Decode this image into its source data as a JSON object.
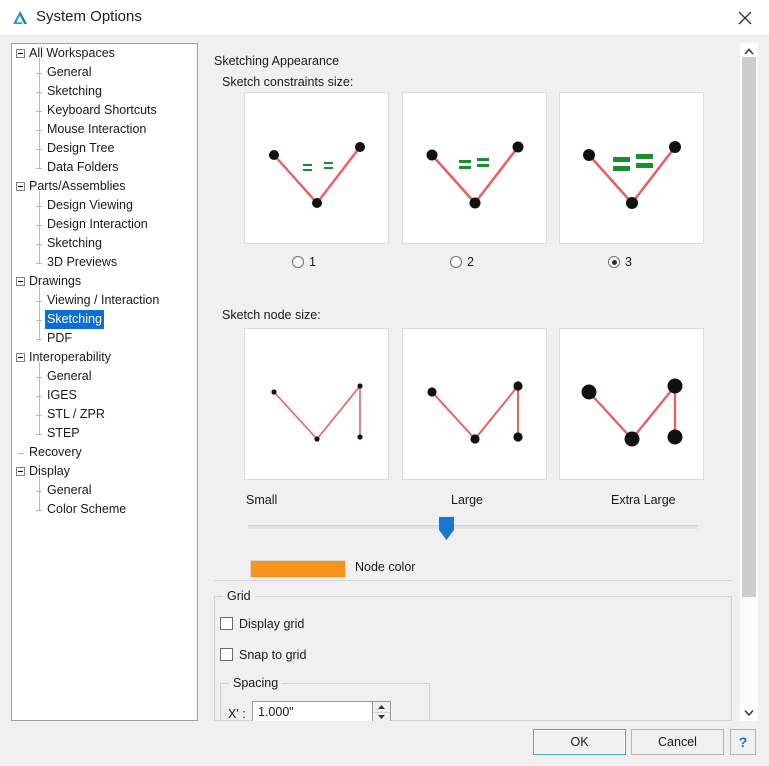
{
  "window": {
    "title": "System Options",
    "icon": "alibre-logo-icon",
    "close_icon": "close-icon"
  },
  "sidebar": {
    "items": [
      {
        "label": "All Workspaces",
        "level": 0,
        "expandable": true,
        "selected": false
      },
      {
        "label": "General",
        "level": 1,
        "expandable": false,
        "selected": false
      },
      {
        "label": "Sketching",
        "level": 1,
        "expandable": false,
        "selected": false
      },
      {
        "label": "Keyboard Shortcuts",
        "level": 1,
        "expandable": false,
        "selected": false
      },
      {
        "label": "Mouse Interaction",
        "level": 1,
        "expandable": false,
        "selected": false
      },
      {
        "label": "Design Tree",
        "level": 1,
        "expandable": false,
        "selected": false
      },
      {
        "label": "Data Folders",
        "level": 1,
        "expandable": false,
        "selected": false
      },
      {
        "label": "Parts/Assemblies",
        "level": 0,
        "expandable": true,
        "selected": false
      },
      {
        "label": "Design Viewing",
        "level": 1,
        "expandable": false,
        "selected": false
      },
      {
        "label": "Design Interaction",
        "level": 1,
        "expandable": false,
        "selected": false
      },
      {
        "label": "Sketching",
        "level": 1,
        "expandable": false,
        "selected": false
      },
      {
        "label": "3D Previews",
        "level": 1,
        "expandable": false,
        "selected": false
      },
      {
        "label": "Drawings",
        "level": 0,
        "expandable": true,
        "selected": false
      },
      {
        "label": "Viewing / Interaction",
        "level": 1,
        "expandable": false,
        "selected": false
      },
      {
        "label": "Sketching",
        "level": 1,
        "expandable": false,
        "selected": true
      },
      {
        "label": "PDF",
        "level": 1,
        "expandable": false,
        "selected": false
      },
      {
        "label": "Interoperability",
        "level": 0,
        "expandable": true,
        "selected": false
      },
      {
        "label": "General",
        "level": 1,
        "expandable": false,
        "selected": false
      },
      {
        "label": "IGES",
        "level": 1,
        "expandable": false,
        "selected": false
      },
      {
        "label": "STL / ZPR",
        "level": 1,
        "expandable": false,
        "selected": false
      },
      {
        "label": "STEP",
        "level": 1,
        "expandable": false,
        "selected": false
      },
      {
        "label": "Recovery",
        "level": 0,
        "expandable": false,
        "selected": false
      },
      {
        "label": "Display",
        "level": 0,
        "expandable": true,
        "selected": false
      },
      {
        "label": "General",
        "level": 1,
        "expandable": false,
        "selected": false
      },
      {
        "label": "Color Scheme",
        "level": 1,
        "expandable": false,
        "selected": false
      }
    ]
  },
  "main": {
    "sketching_appearance": {
      "title": "Sketching Appearance",
      "constraints": {
        "label": "Sketch constraints size:",
        "selected_value": "3",
        "options": [
          {
            "label": "1",
            "selected": false
          },
          {
            "label": "2",
            "selected": false
          },
          {
            "label": "3",
            "selected": true
          }
        ]
      },
      "node_size": {
        "label": "Sketch node size:",
        "ticks": [
          "Small",
          "Large",
          "Extra Large"
        ],
        "selected_tick": "Large",
        "slider_position_percent": 44
      },
      "node_color": {
        "label": "Node color",
        "color": "#f7941e"
      }
    },
    "grid": {
      "legend": "Grid",
      "display_grid": {
        "label": "Display grid",
        "checked": false
      },
      "snap_to_grid": {
        "label": "Snap to grid",
        "checked": false
      },
      "spacing": {
        "legend": "Spacing",
        "x_label": "X' :",
        "x_value": "1.000\""
      }
    }
  },
  "footer": {
    "ok": "OK",
    "cancel": "Cancel",
    "help": "?"
  },
  "colors": {
    "selection_blue": "#0b6ed8",
    "node_orange": "#f7941e",
    "sketch_line_red": "#e8605f",
    "constraint_green": "#1a8f2e",
    "slider_blue": "#1878d0",
    "help_blue": "#1573c4"
  }
}
